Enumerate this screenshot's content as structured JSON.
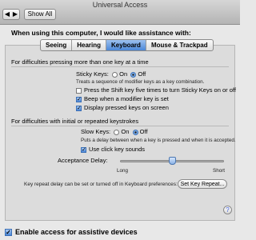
{
  "window": {
    "title": "Universal Access"
  },
  "toolbar": {
    "back_glyph": "◀",
    "forward_glyph": "▶",
    "show_all_label": "Show All"
  },
  "header": {
    "using_text": "When using this computer, I would like assistance with:"
  },
  "tabs": [
    {
      "label": "Seeing",
      "selected": false
    },
    {
      "label": "Hearing",
      "selected": false
    },
    {
      "label": "Keyboard",
      "selected": true
    },
    {
      "label": "Mouse & Trackpad",
      "selected": false
    }
  ],
  "sticky": {
    "section_title": "For difficulties pressing more than one key at a time",
    "label": "Sticky Keys:",
    "on_label": "On",
    "off_label": "Off",
    "state": "off",
    "description": "Treats a sequence of modifier keys as a key combination.",
    "options": [
      {
        "label": "Press the Shift key five times to turn Sticky Keys on or off",
        "checked": false
      },
      {
        "label": "Beep when a modifier key is set",
        "checked": true
      },
      {
        "label": "Display pressed keys on screen",
        "checked": true
      }
    ]
  },
  "slow": {
    "section_title": "For difficulties with initial or repeated keystrokes",
    "label": "Slow Keys:",
    "on_label": "On",
    "off_label": "Off",
    "state": "off",
    "description": "Puts a delay between when a key is pressed and when it is accepted.",
    "click_sounds_label": "Use click key sounds",
    "click_sounds_checked": true,
    "acceptance_label": "Acceptance Delay:",
    "slider_min_label": "Long",
    "slider_max_label": "Short",
    "acceptance_value": 0.5
  },
  "key_repeat": {
    "text": "Key repeat delay can be set or turned off in Keyboard preferences:",
    "button_label": "Set Key Repeat..."
  },
  "help_glyph": "?",
  "assistive": {
    "label": "Enable access for assistive devices",
    "checked": true
  },
  "check_glyph": "✓"
}
